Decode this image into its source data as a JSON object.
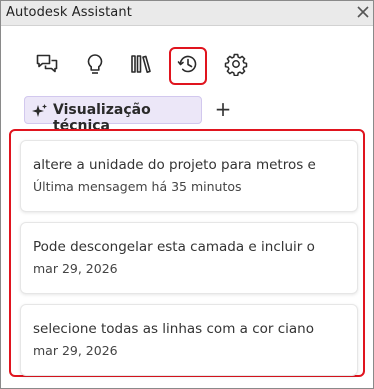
{
  "window": {
    "title": "Autodesk Assistant"
  },
  "toolbar": {
    "tools": [
      {
        "icon": "chat-bubbles-icon",
        "name": "tool-chat"
      },
      {
        "icon": "lightbulb-icon",
        "name": "tool-tips"
      },
      {
        "icon": "library-icon",
        "name": "tool-library"
      },
      {
        "icon": "history-icon",
        "name": "tool-history",
        "active": true
      },
      {
        "icon": "gear-icon",
        "name": "tool-settings"
      }
    ]
  },
  "tabs": {
    "items": [
      {
        "label": "Visualização técnica",
        "icon": "sparkle-icon"
      }
    ],
    "add_label": "+"
  },
  "history": {
    "items": [
      {
        "title": "altere a unidade do projeto para metros e",
        "meta": "Última mensagem há 35 minutos"
      },
      {
        "title": "Pode descongelar esta camada e incluir o",
        "meta": "mar 29, 2026"
      },
      {
        "title": "selecione todas as linhas com a cor ciano",
        "meta": "mar 29, 2026"
      }
    ]
  },
  "colors": {
    "highlight": "#e0141e",
    "tab_bg": "#ece7f8",
    "titlebar_bg": "#eaeaea"
  }
}
